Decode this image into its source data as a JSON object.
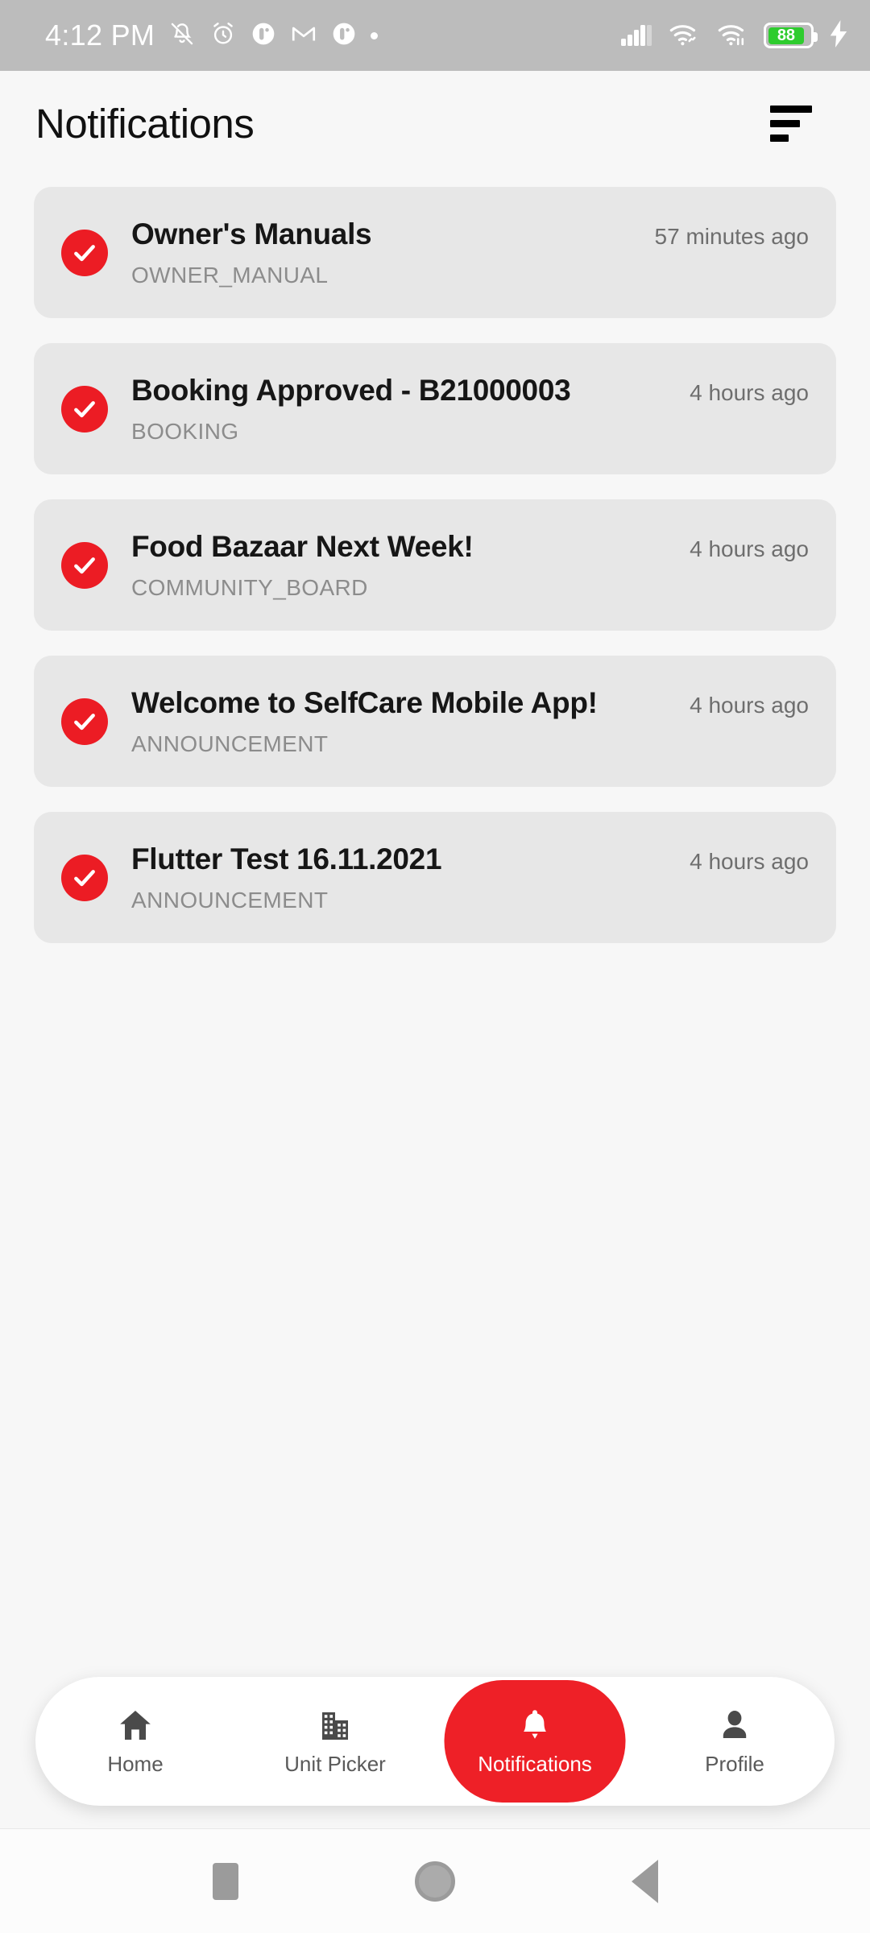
{
  "status_bar": {
    "time": "4:12 PM",
    "battery_percent": "88",
    "icons": [
      "bell-off-icon",
      "alarm-icon",
      "app-circle-icon",
      "gmail-icon",
      "app-circle-icon",
      "dot-icon"
    ],
    "right_icons": [
      "signal-bars-icon",
      "wifi-link-icon",
      "wifi-transfer-icon",
      "battery-icon",
      "charging-bolt-icon"
    ]
  },
  "header": {
    "title": "Notifications",
    "filter_icon": "sort-filter-icon"
  },
  "notifications": [
    {
      "icon": "check-circle-icon",
      "title": "Owner's Manuals",
      "category": "OWNER_MANUAL",
      "time": "57 minutes ago"
    },
    {
      "icon": "check-circle-icon",
      "title": "Booking Approved - B21000003",
      "category": "BOOKING",
      "time": "4 hours ago"
    },
    {
      "icon": "check-circle-icon",
      "title": "Food Bazaar Next Week!",
      "category": "COMMUNITY_BOARD",
      "time": "4 hours ago"
    },
    {
      "icon": "check-circle-icon",
      "title": "Welcome to SelfCare Mobile App!",
      "category": "ANNOUNCEMENT",
      "time": "4 hours ago"
    },
    {
      "icon": "check-circle-icon",
      "title": "Flutter Test 16.11.2021",
      "category": "ANNOUNCEMENT",
      "time": "4 hours ago"
    }
  ],
  "bottom_nav": {
    "items": [
      {
        "label": "Home",
        "icon": "home-icon",
        "active": false
      },
      {
        "label": "Unit Picker",
        "icon": "building-icon",
        "active": false
      },
      {
        "label": "Notifications",
        "icon": "bell-icon",
        "active": true
      },
      {
        "label": "Profile",
        "icon": "person-icon",
        "active": false
      }
    ]
  },
  "system_nav": {
    "recents_label": "recent-apps",
    "home_label": "home",
    "back_label": "back"
  },
  "colors": {
    "accent": "#EC1C24",
    "card_bg": "#E7E7E7",
    "page_bg": "#F7F7F7",
    "status_bar_bg": "#BCBCBC",
    "battery_green": "#2ECC2E"
  }
}
